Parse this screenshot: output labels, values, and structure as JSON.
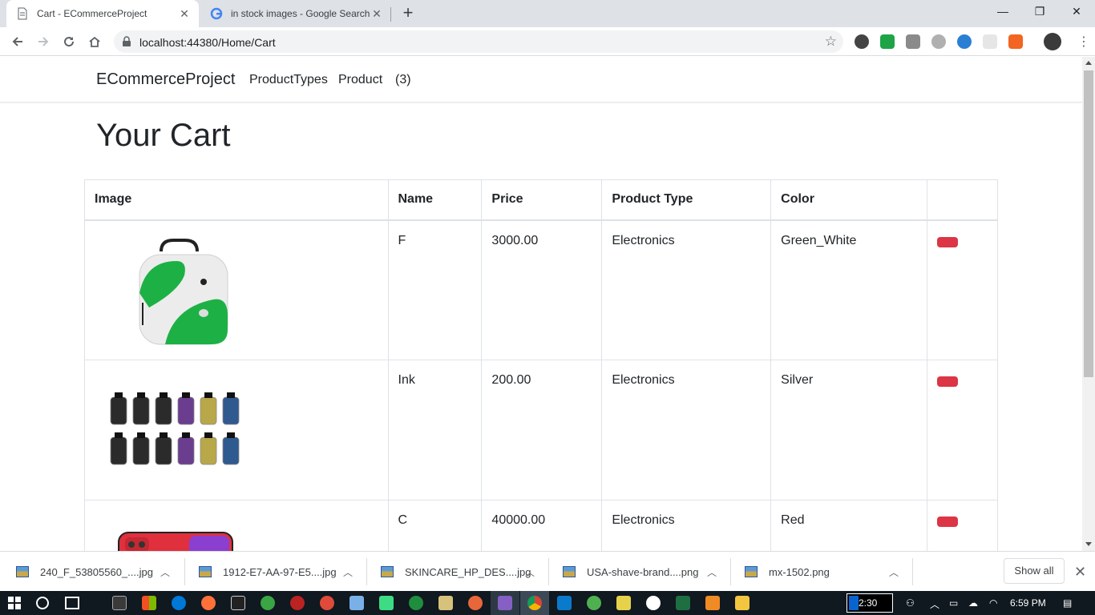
{
  "browser": {
    "tabs": [
      {
        "title": "Cart - ECommerceProject",
        "active": true
      },
      {
        "title": "in stock images - Google Search",
        "active": false
      }
    ],
    "url": "localhost:44380/Home/Cart",
    "window_controls": {
      "minimize": "—",
      "restore": "❐",
      "close": "✕"
    }
  },
  "site_nav": {
    "brand": "ECommerceProject",
    "links": [
      {
        "label": "ProductTypes"
      },
      {
        "label": "Product"
      },
      {
        "label": "(3)"
      }
    ]
  },
  "heading": "Your Cart",
  "table": {
    "headers": [
      "Image",
      "Name",
      "Price",
      "Product Type",
      "Color",
      ""
    ],
    "rows": [
      {
        "image": "green-white-backpack",
        "name": "F",
        "price": "3000.00",
        "product_type": "Electronics",
        "color": "Green_White"
      },
      {
        "image": "vape-tanks-grid",
        "name": "Ink",
        "price": "200.00",
        "product_type": "Electronics",
        "color": "Silver"
      },
      {
        "image": "red-phone",
        "name": "C",
        "price": "40000.00",
        "product_type": "Electronics",
        "color": "Red"
      }
    ],
    "delete_color": "#dc3545"
  },
  "downloads": [
    {
      "name": "240_F_53805560_....jpg"
    },
    {
      "name": "1912-E7-AA-97-E5....jpg"
    },
    {
      "name": "SKINCARE_HP_DES....jpg"
    },
    {
      "name": "USA-shave-brand....png"
    },
    {
      "name": "mx-1502.png"
    }
  ],
  "show_all": "Show all",
  "taskbar": {
    "clock": "6:59 PM",
    "box_value": "2:30"
  }
}
